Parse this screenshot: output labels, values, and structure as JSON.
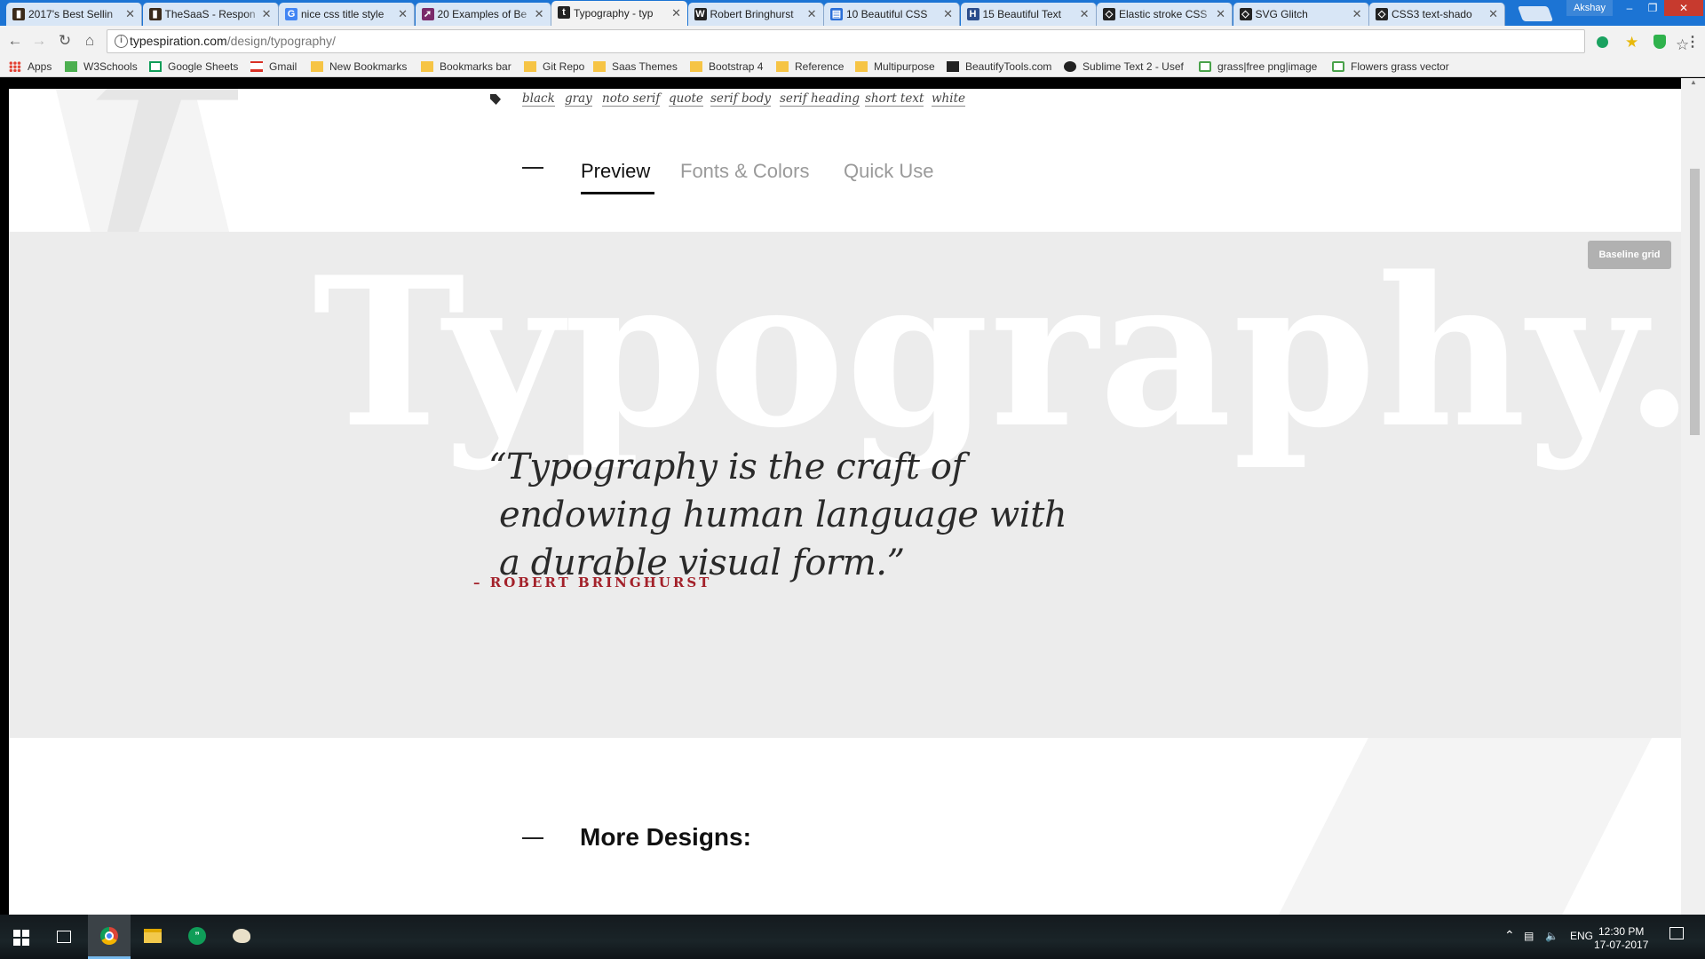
{
  "browser": {
    "tabs": [
      {
        "title": "2017's Best Sellin",
        "icon": "themeforest-icon",
        "color": "#3a2a1a"
      },
      {
        "title": "TheSaaS - Respon",
        "icon": "themeforest-icon",
        "color": "#3a2a1a"
      },
      {
        "title": "nice css title style",
        "icon": "google-icon",
        "color": "#4285f4"
      },
      {
        "title": "20 Examples of Be",
        "icon": "arrow-icon",
        "color": "#7a2a6a"
      },
      {
        "title": "Typography - typ",
        "icon": "typespiration-icon",
        "color": "#222222"
      },
      {
        "title": "Robert Bringhurst",
        "icon": "wikipedia-icon",
        "color": "#222222"
      },
      {
        "title": "10 Beautiful CSS",
        "icon": "document-icon",
        "color": "#2a6fd8"
      },
      {
        "title": "15 Beautiful Text",
        "icon": "h-icon",
        "color": "#2b4d8c"
      },
      {
        "title": "Elastic stroke CSS",
        "icon": "codepen-icon",
        "color": "#222222"
      },
      {
        "title": "SVG Glitch",
        "icon": "codepen-icon",
        "color": "#222222"
      },
      {
        "title": "CSS3 text-shado",
        "icon": "codepen-icon",
        "color": "#222222"
      }
    ],
    "active_tab": 4,
    "profile": "Akshay",
    "url_host": "typespiration.com",
    "url_path": "/design/typography/",
    "bookmarks": [
      {
        "label": "Apps",
        "icon": "apps-grid-icon"
      },
      {
        "label": "W3Schools",
        "icon": "w3schools-icon"
      },
      {
        "label": "Google Sheets",
        "icon": "sheets-icon"
      },
      {
        "label": "Gmail",
        "icon": "gmail-icon"
      },
      {
        "label": "New Bookmarks",
        "icon": "folder-icon"
      },
      {
        "label": "Bookmarks bar",
        "icon": "folder-icon"
      },
      {
        "label": "Git Repo",
        "icon": "folder-icon"
      },
      {
        "label": "Saas Themes",
        "icon": "folder-icon"
      },
      {
        "label": "Bootstrap 4",
        "icon": "folder-icon"
      },
      {
        "label": "Reference",
        "icon": "folder-icon"
      },
      {
        "label": "Multipurpose",
        "icon": "folder-icon"
      },
      {
        "label": "BeautifyTools.com",
        "icon": "bt-icon"
      },
      {
        "label": "Sublime Text 2 - Usef",
        "icon": "github-icon"
      },
      {
        "label": "grass|free png|image",
        "icon": "freepik-icon"
      },
      {
        "label": "Flowers grass vector",
        "icon": "freepik-icon"
      }
    ]
  },
  "page": {
    "tags": [
      "black",
      "gray",
      "noto serif",
      "quote",
      "serif body",
      "serif heading",
      "short text",
      "white"
    ],
    "nav_tabs": {
      "preview": "Preview",
      "fonts": "Fonts & Colors",
      "quick": "Quick Use"
    },
    "bg_word": "Typography.",
    "baseline_button": "Baseline grid",
    "quote_lines": [
      "“Typography is the craft of",
      "endowing human language with",
      "a durable visual form.”"
    ],
    "author": "– ROBERT BRINGHURST",
    "more_title": "More Designs:",
    "colors": {
      "author": "#a3212a",
      "preview_bg": "#ececec"
    }
  },
  "taskbar": {
    "apps": [
      "start-icon",
      "task-view-icon",
      "chrome-icon",
      "file-explorer-icon",
      "hangouts-icon",
      "paint-icon"
    ],
    "lang": "ENG",
    "time": "12:30 PM",
    "date": "17-07-2017"
  }
}
